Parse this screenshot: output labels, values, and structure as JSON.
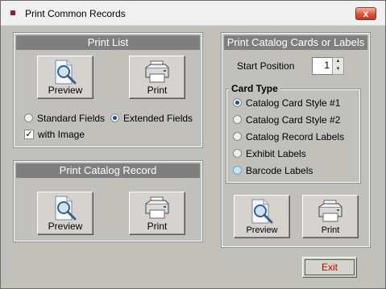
{
  "window": {
    "title": "Print Common Records",
    "close_label": "x"
  },
  "print_list": {
    "title": "Print List",
    "preview_label": "Preview",
    "print_label": "Print",
    "standard_fields": "Standard Fields",
    "extended_fields": "Extended Fields",
    "with_image": "with Image",
    "selected_fields": "Extended Fields",
    "with_image_checked": true
  },
  "print_catalog_record": {
    "title": "Print Catalog Record",
    "preview_label": "Preview",
    "print_label": "Print"
  },
  "print_cards": {
    "title": "Print Catalog Cards or Labels",
    "start_position_label": "Start Position",
    "start_position_value": "1",
    "card_type_label": "Card Type",
    "options": [
      "Catalog Card Style #1",
      "Catalog Card Style #2",
      "Catalog Record Labels",
      "Exhibit Labels",
      "Barcode Labels"
    ],
    "selected_option": "Catalog Card Style #1",
    "preview_label": "Preview",
    "print_label": "Print"
  },
  "footer": {
    "exit_label": "Exit"
  },
  "colors": {
    "panel_header": "#7f7f7f",
    "background": "#c2c0bb",
    "exit_text": "#c00000",
    "radio_selected": "#1c4f99"
  }
}
